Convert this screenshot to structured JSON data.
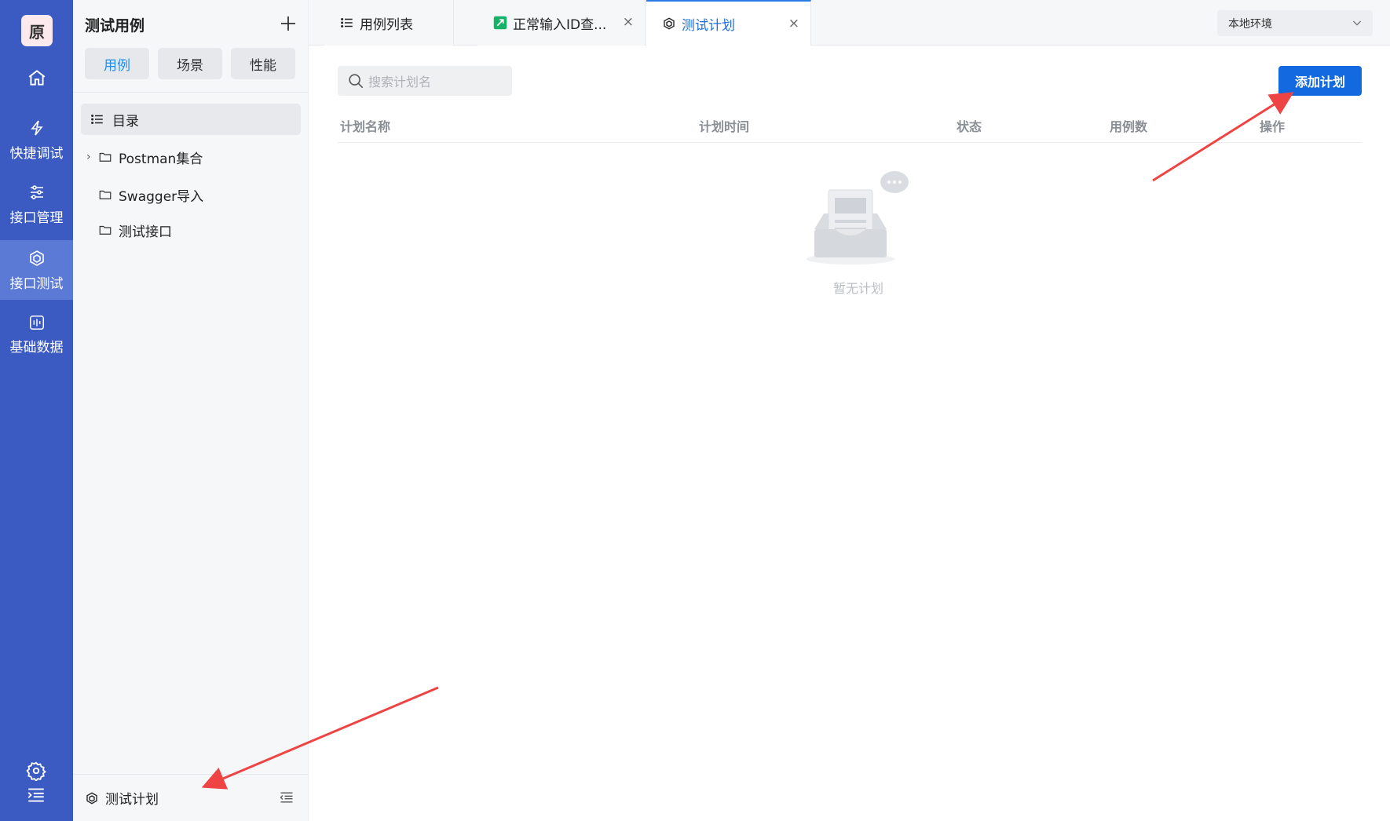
{
  "rail": {
    "logo": "原",
    "items": [
      {
        "label": ""
      },
      {
        "label": "快捷调试"
      },
      {
        "label": "接口管理"
      },
      {
        "label": "接口测试"
      },
      {
        "label": "基础数据"
      }
    ]
  },
  "sidebar": {
    "title": "测试用例",
    "tabs": [
      "用例",
      "场景",
      "性能"
    ],
    "tree_root": "目录",
    "tree_items": [
      "Postman集合",
      "Swagger导入",
      "测试接口"
    ],
    "footer_label": "测试计划"
  },
  "tabs": [
    {
      "label": "用例列表"
    },
    {
      "label": "正常输入ID查..."
    },
    {
      "label": "测试计划"
    }
  ],
  "env_select": {
    "value": "本地环境"
  },
  "search": {
    "placeholder": "搜索计划名"
  },
  "add_button": "添加计划",
  "table": {
    "headers": [
      "计划名称",
      "计划时间",
      "状态",
      "用例数",
      "操作"
    ]
  },
  "empty_text": "暂无计划",
  "colors": {
    "rail": "#3b5bc2",
    "primary": "#1269e0",
    "accent_tab": "#1f8ff0",
    "annotation_arrow": "#ef4444"
  }
}
